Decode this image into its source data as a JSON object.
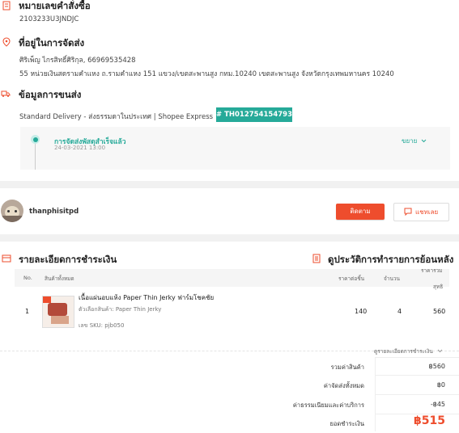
{
  "order_number": {
    "title": "หมายเลขคำสั่งซื้อ",
    "value": "2103233U3JNDJC"
  },
  "address": {
    "title": "ที่อยู่ในการจัดส่ง",
    "name_phone": "ศิริเพ็ญ ไกรสิทธิ์ศิริกุล, 66969535428",
    "line": "55 หน่วยเงินสดรามคำแหง  ถ.รามคำแหง 151 แขวง/เขตสะพานสูง กทม.10240 เขตสะพานสูง จังหวัดกรุงเทพมหานคร 10240"
  },
  "shipping": {
    "title": "ข้อมูลการขนส่ง",
    "carrier": "Standard Delivery - ส่งธรรมดาในประเทศ | Shopee Express",
    "tracking": "# TH012754154793",
    "status": "การจัดส่งพัสดุสำเร็จแล้ว",
    "timestamp": "24-03-2021 13:00",
    "expand_label": "ขยาย"
  },
  "seller": {
    "name": "thanphisitpd",
    "follow_label": "ติดตาม",
    "chat_label": "แชทเลย"
  },
  "payment": {
    "title": "รายละเอียดการชำระเงิน",
    "history_link": "ดูประวัติการทำรายการย้อนหลัง",
    "headers": {
      "no": "No.",
      "product": "สินค้าทั้งหมด",
      "unit_price": "ราคาต่อชิ้น",
      "qty": "จำนวน",
      "subtotal_1": "ราคารวม",
      "subtotal_2": "สุทธิ"
    },
    "items": [
      {
        "no": "1",
        "name": "เนื้อแผ่นอบแห้ง Paper Thin Jerky ฟาร์มโชคชัย",
        "variation": "ตัวเลือกสินค้า: Paper Thin Jerky",
        "sku": "เลข SKU:  pjb050",
        "unit_price": "140",
        "qty": "4",
        "subtotal": "560"
      }
    ],
    "summary_toggle": "ดูรายละเอียดการชำระเงิน",
    "summary": [
      {
        "label": "รวมค่าสินค้า",
        "value": "฿560"
      },
      {
        "label": "ค่าจัดส่งทั้งหมด",
        "value": "฿0"
      },
      {
        "label": "ค่าธรรมเนียมและค่าบริการ",
        "value": "-฿45"
      }
    ],
    "total_label": "ยอดชำระเงิน",
    "total_value": "฿515"
  },
  "colors": {
    "accent": "#ee4d2d",
    "teal": "#26aa99"
  }
}
